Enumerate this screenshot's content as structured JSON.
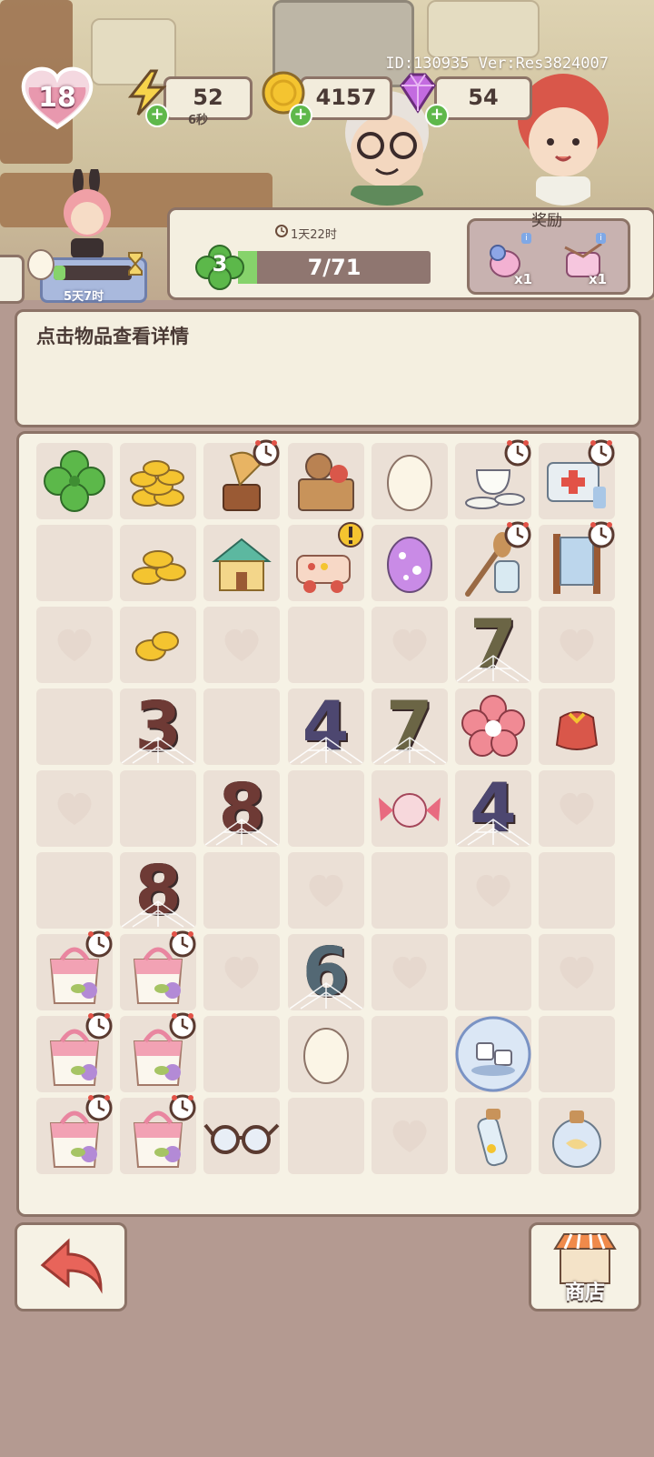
{
  "header": {
    "id_version": "ID:130935 Ver:Res3824007",
    "level": "18",
    "energy": {
      "value": "52",
      "regen": "6秒",
      "icon": "lightning-icon"
    },
    "coins": {
      "value": "4157",
      "icon": "coin-icon"
    },
    "gems": {
      "value": "54",
      "icon": "gem-icon"
    },
    "egg_timer": "5天7时",
    "egg_progress": 0.15
  },
  "task": {
    "timer": "1天22时",
    "clover_level": "3",
    "progress_text": "7/71",
    "progress_fraction": 0.0986,
    "reward_title": "奖励",
    "rewards": [
      {
        "name": "pink-bottle",
        "count": "x1"
      },
      {
        "name": "pink-cushion",
        "count": "x1"
      }
    ]
  },
  "detail": {
    "text": "点击物品查看详情"
  },
  "board": {
    "columns": 7,
    "rows": 9,
    "cells": [
      [
        "clover",
        "coins-large",
        "gramophone",
        "toy-box",
        "egg-white",
        "tea-set",
        "first-aid-kit"
      ],
      [
        "heart-empty",
        "coins-medium",
        "toy-house",
        "toy-car",
        "egg-purple",
        "spoon-jar",
        "mirror-stand"
      ],
      [
        "heart",
        "coins-small",
        "heart",
        "heart-empty",
        "heart",
        "num-7",
        "heart"
      ],
      [
        "heart-empty",
        "num-3",
        "heart-empty",
        "num-4",
        "num-7",
        "flower",
        "gift-bag"
      ],
      [
        "heart",
        "heart-empty",
        "num-8",
        "heart-empty",
        "candy",
        "num-4",
        "heart"
      ],
      [
        "heart-empty",
        "num-8",
        "heart-empty",
        "heart",
        "heart-empty",
        "heart",
        "heart-empty"
      ],
      [
        "bag",
        "bag",
        "heart",
        "num-6",
        "heart",
        "heart-empty",
        "heart"
      ],
      [
        "bag",
        "bag",
        "heart-empty",
        "egg-white",
        "heart-empty",
        "bubble-cups",
        "heart-empty"
      ],
      [
        "bag",
        "bag",
        "glasses",
        "heart-empty",
        "heart",
        "bottle-pills",
        "bottle-round"
      ]
    ],
    "timers": [
      "gramophone",
      "tea-set",
      "first-aid-kit",
      "spoon-jar",
      "mirror-stand",
      "bag"
    ],
    "alert": [
      "toy-car"
    ],
    "numbers": {
      "num-3": {
        "label": "3",
        "color": "#6e3a35"
      },
      "num-4": {
        "label": "4",
        "color": "#4d4770"
      },
      "num-6": {
        "label": "6",
        "color": "#536874"
      },
      "num-7": {
        "label": "7",
        "color": "#6b6545"
      },
      "num-8": {
        "label": "8",
        "color": "#6e3a35"
      }
    }
  },
  "footer": {
    "back_icon": "back-arrow-icon",
    "shop_label": "商店",
    "shop_icon": "shop-icon"
  },
  "colors": {
    "panel_bg": "#f4efe0",
    "border": "#8c7367",
    "cell": "#ebe0d6",
    "green": "#86d36b",
    "background": "#b49a91"
  }
}
